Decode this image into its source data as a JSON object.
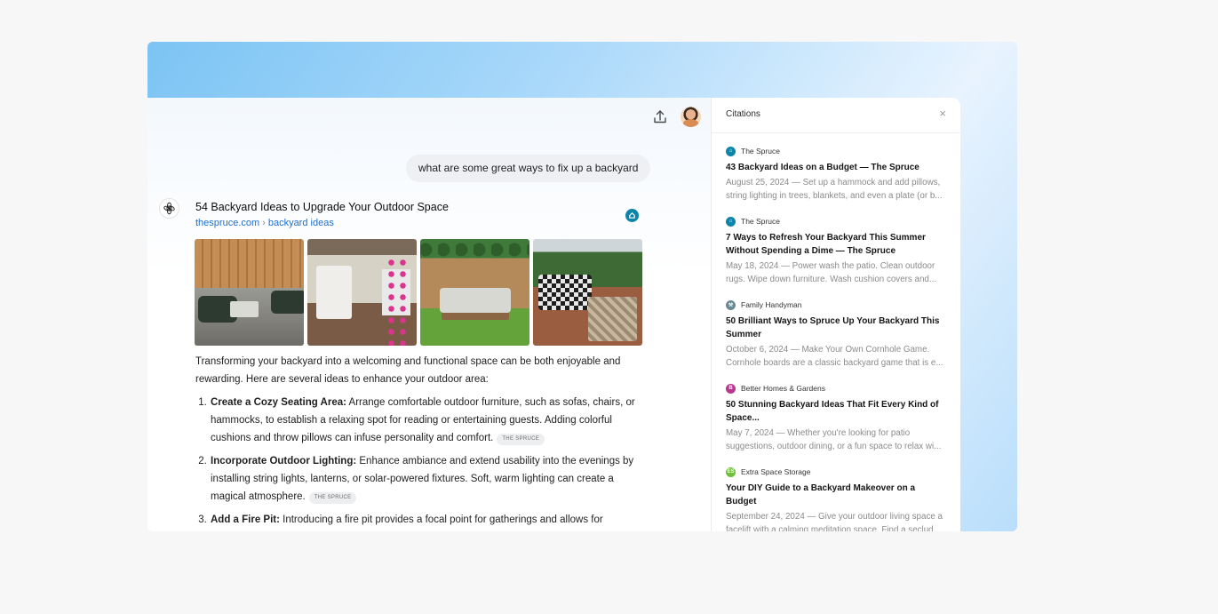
{
  "colors": {
    "accent_link": "#1a6fd1",
    "source_badge": "#0e85a8"
  },
  "header": {
    "share_icon": "share-icon",
    "avatar": "user-avatar"
  },
  "user_message": "what are some great ways to fix up a backyard",
  "result": {
    "title": "54 Backyard Ideas to Upgrade Your Outdoor Space",
    "domain": "thespruce.com",
    "breadcrumb_sep": "›",
    "path": "backyard ideas"
  },
  "intro": "Transforming your backyard into a welcoming and functional space can be both enjoyable and rewarding. Here are several ideas to enhance your outdoor area:",
  "ideas": [
    {
      "heading": "Create a Cozy Seating Area:",
      "text": " Arrange comfortable outdoor furniture, such as sofas, chairs, or hammocks, to establish a relaxing spot for reading or entertaining guests. Adding colorful cushions and throw pillows can infuse personality and comfort.",
      "source": "THE SPRUCE"
    },
    {
      "heading": "Incorporate Outdoor Lighting:",
      "text": " Enhance ambiance and extend usability into the evenings by installing string lights, lanterns, or solar-powered fixtures. Soft, warm lighting can create a magical atmosphere.",
      "source": "THE SPRUCE"
    },
    {
      "heading": "Add a Fire Pit:",
      "text": " Introducing a fire pit provides a focal point for gatherings and allows for enjoyable",
      "source": ""
    }
  ],
  "citations": {
    "title": "Citations",
    "close_label": "×",
    "items": [
      {
        "source": "The Spruce",
        "fav_color": "#0e85a8",
        "fav_glyph": "⌂",
        "title": "43 Backyard Ideas on a Budget — The Spruce",
        "snippet_1": "August 25, 2024 — Set up a hammock and add pillows,",
        "snippet_2": "string lighting in trees, blankets, and even a plate (or b..."
      },
      {
        "source": "The Spruce",
        "fav_color": "#0e85a8",
        "fav_glyph": "⌂",
        "title": "7 Ways to Refresh Your Backyard This Summer Without Spending a Dime — The Spruce",
        "snippet_1": "May 18, 2024 — Power wash the patio. Clean outdoor",
        "snippet_2": "rugs. Wipe down furniture. Wash cushion covers and..."
      },
      {
        "source": "Family Handyman",
        "fav_color": "#6b8a96",
        "fav_glyph": "⚒",
        "title": "50 Brilliant Ways to Spruce Up Your Backyard This Summer",
        "snippet_1": "October 6, 2024 — Make Your Own Cornhole Game.",
        "snippet_2": "Cornhole boards are a classic backyard game that is e..."
      },
      {
        "source": "Better Homes & Gardens",
        "fav_color": "#b8388f",
        "fav_glyph": "B",
        "title": "50 Stunning Backyard Ideas That Fit Every Kind of Space...",
        "snippet_1": "May 7, 2024 — Whether you're looking for patio",
        "snippet_2": "suggestions, outdoor dining, or a fun space to relax wi..."
      },
      {
        "source": "Extra Space Storage",
        "fav_color": "#6fbf3a",
        "fav_glyph": "ES",
        "title": "Your DIY Guide to a Backyard Makeover on a Budget",
        "snippet_1": "September 24, 2024 — Give your outdoor living space a",
        "snippet_2": "facelift with a calming meditation space. Find a seclud..."
      }
    ]
  }
}
